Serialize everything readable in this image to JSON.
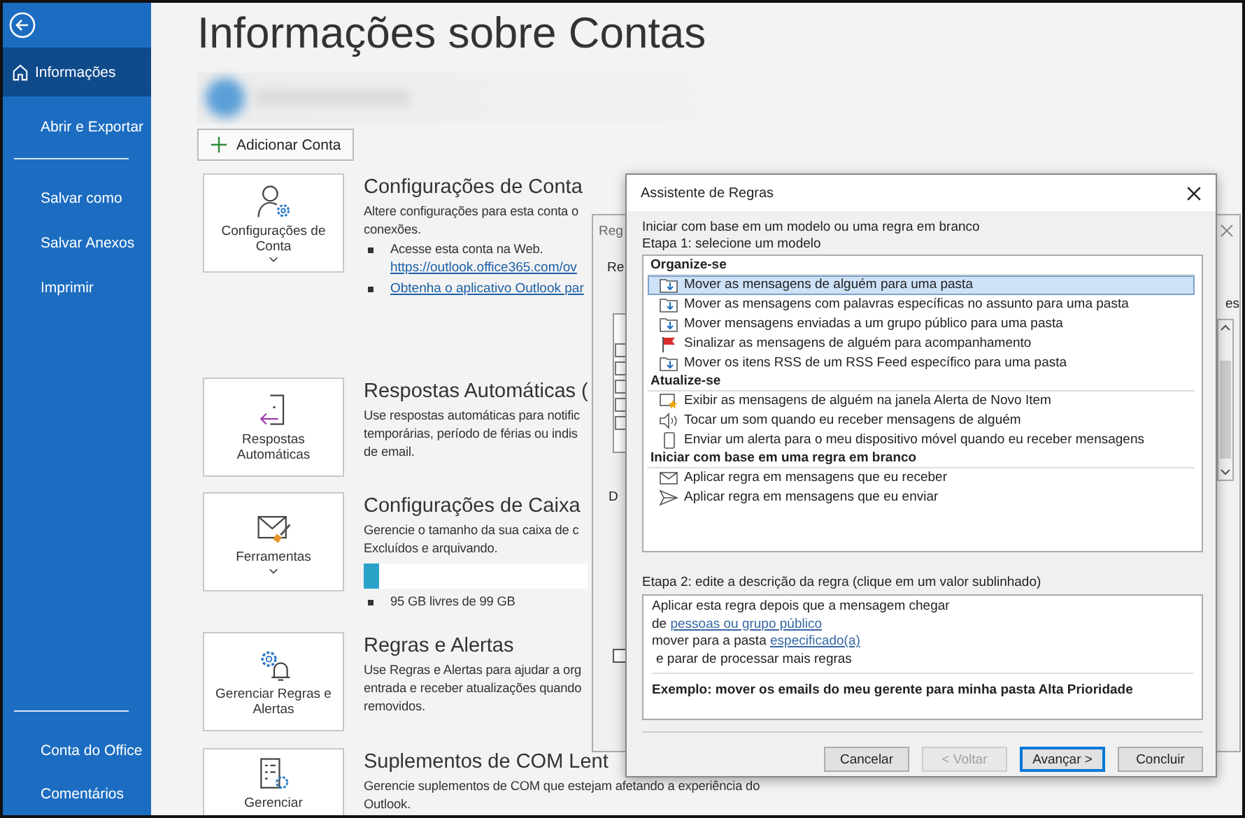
{
  "sidebar": {
    "items": [
      {
        "label": "Informações",
        "selected": true
      },
      {
        "label": "Abrir e Exportar",
        "selected": false
      },
      {
        "label": "Salvar como",
        "selected": false
      },
      {
        "label": "Salvar Anexos",
        "selected": false
      },
      {
        "label": "Imprimir",
        "selected": false
      }
    ],
    "footer_items": [
      {
        "label": "Conta do Office"
      },
      {
        "label": "Comentários"
      }
    ]
  },
  "page": {
    "title": "Informações sobre Contas",
    "add_account_button": "Adicionar Conta",
    "sections": [
      {
        "kind": "bullets",
        "card_label": "Configurações de Conta",
        "dropdown": true,
        "heading": "Configurações de Conta",
        "body_lines": [
          "Altere configurações para esta conta o",
          "conexões."
        ],
        "bullets": [
          {
            "text": "Acesse esta conta na Web.",
            "link": "https://outlook.office365.com/ov"
          },
          {
            "link": "Obtenha o aplicativo Outlook par"
          }
        ]
      },
      {
        "kind": "plain",
        "card_label": "Respostas Automáticas",
        "dropdown": false,
        "heading": "Respostas Automáticas (",
        "body_lines": [
          "Use respostas automáticas para notific",
          "temporárias, período de férias ou indis",
          "de email."
        ]
      },
      {
        "kind": "storage",
        "card_label": "Ferramentas",
        "dropdown": true,
        "heading": "Configurações de Caixa",
        "body_lines": [
          "Gerencie o tamanho da sua caixa de c",
          "Excluídos e arquivando."
        ],
        "level": 0.07,
        "bullets": [
          {
            "text": "95 GB livres de 99 GB"
          }
        ]
      },
      {
        "kind": "plain",
        "card_label": "Gerenciar Regras e Alertas",
        "dropdown": false,
        "heading": "Regras e Alertas",
        "body_lines": [
          "Use Regras e Alertas para ajudar a org",
          "entrada e receber atualizações quando",
          "removidos."
        ]
      },
      {
        "kind": "plain",
        "card_label": "Gerenciar",
        "dropdown": false,
        "heading": "Suplementos de COM Lent",
        "body_lines": [
          "Gerencie suplementos de COM que estejam afetando a experiência do",
          "Outlook."
        ]
      }
    ]
  },
  "background_dialog": {
    "title": "Reg",
    "texts": [
      "Re",
      "D",
      "es"
    ],
    "checked": false
  },
  "dialog": {
    "title": "Assistente de Regras",
    "intro": "Iniciar com base em um modelo ou uma regra em branco",
    "step1": "Etapa 1: selecione um modelo",
    "groups": [
      {
        "header": "Organize-se",
        "items": [
          {
            "kind": "move",
            "text": "Mover as mensagens de alguém para uma pasta",
            "selected": true
          },
          {
            "kind": "move",
            "text": "Mover as mensagens com palavras específicas no assunto para uma pasta",
            "selected": false
          },
          {
            "kind": "move",
            "text": "Mover mensagens enviadas a um grupo público para uma pasta",
            "selected": false
          },
          {
            "kind": "flag",
            "text": "Sinalizar as mensagens de alguém para acompanhamento",
            "selected": false
          },
          {
            "kind": "move",
            "text": "Mover os itens RSS de um RSS Feed específico para uma pasta",
            "selected": false
          }
        ]
      },
      {
        "header": "Atualize-se",
        "items": [
          {
            "kind": "alert",
            "text": "Exibir as mensagens de alguém na janela Alerta de Novo Item",
            "selected": false
          },
          {
            "kind": "sound",
            "text": "Tocar um som quando eu receber mensagens de alguém",
            "selected": false
          },
          {
            "kind": "mobile",
            "text": "Enviar um alerta para o meu dispositivo móvel quando eu receber mensagens",
            "selected": false
          }
        ]
      },
      {
        "header": "Iniciar com base em uma regra em branco",
        "items": [
          {
            "kind": "receive",
            "text": "Aplicar regra em mensagens que eu receber",
            "selected": false
          },
          {
            "kind": "send",
            "text": "Aplicar regra em mensagens que eu enviar",
            "selected": false
          }
        ]
      }
    ],
    "step2": "Etapa 2: edite a descrição da regra (clique em um valor sublinhado)",
    "description_lines": [
      {
        "text": "Aplicar esta regra depois que a mensagem chegar"
      },
      {
        "text": "de",
        "link": "pessoas ou grupo público"
      },
      {
        "text": "mover para a pasta",
        "link": "especificado(a)"
      },
      {
        "text": "e parar de processar mais regras"
      }
    ],
    "example": "Exemplo: mover os emails do meu gerente para minha pasta Alta Prioridade",
    "buttons": [
      {
        "label": "Cancelar",
        "disabled": false,
        "default": false
      },
      {
        "label": "< Voltar",
        "disabled": true,
        "default": false
      },
      {
        "label": "Avançar >",
        "disabled": false,
        "default": true
      },
      {
        "label": "Concluir",
        "disabled": false,
        "default": false
      }
    ]
  }
}
